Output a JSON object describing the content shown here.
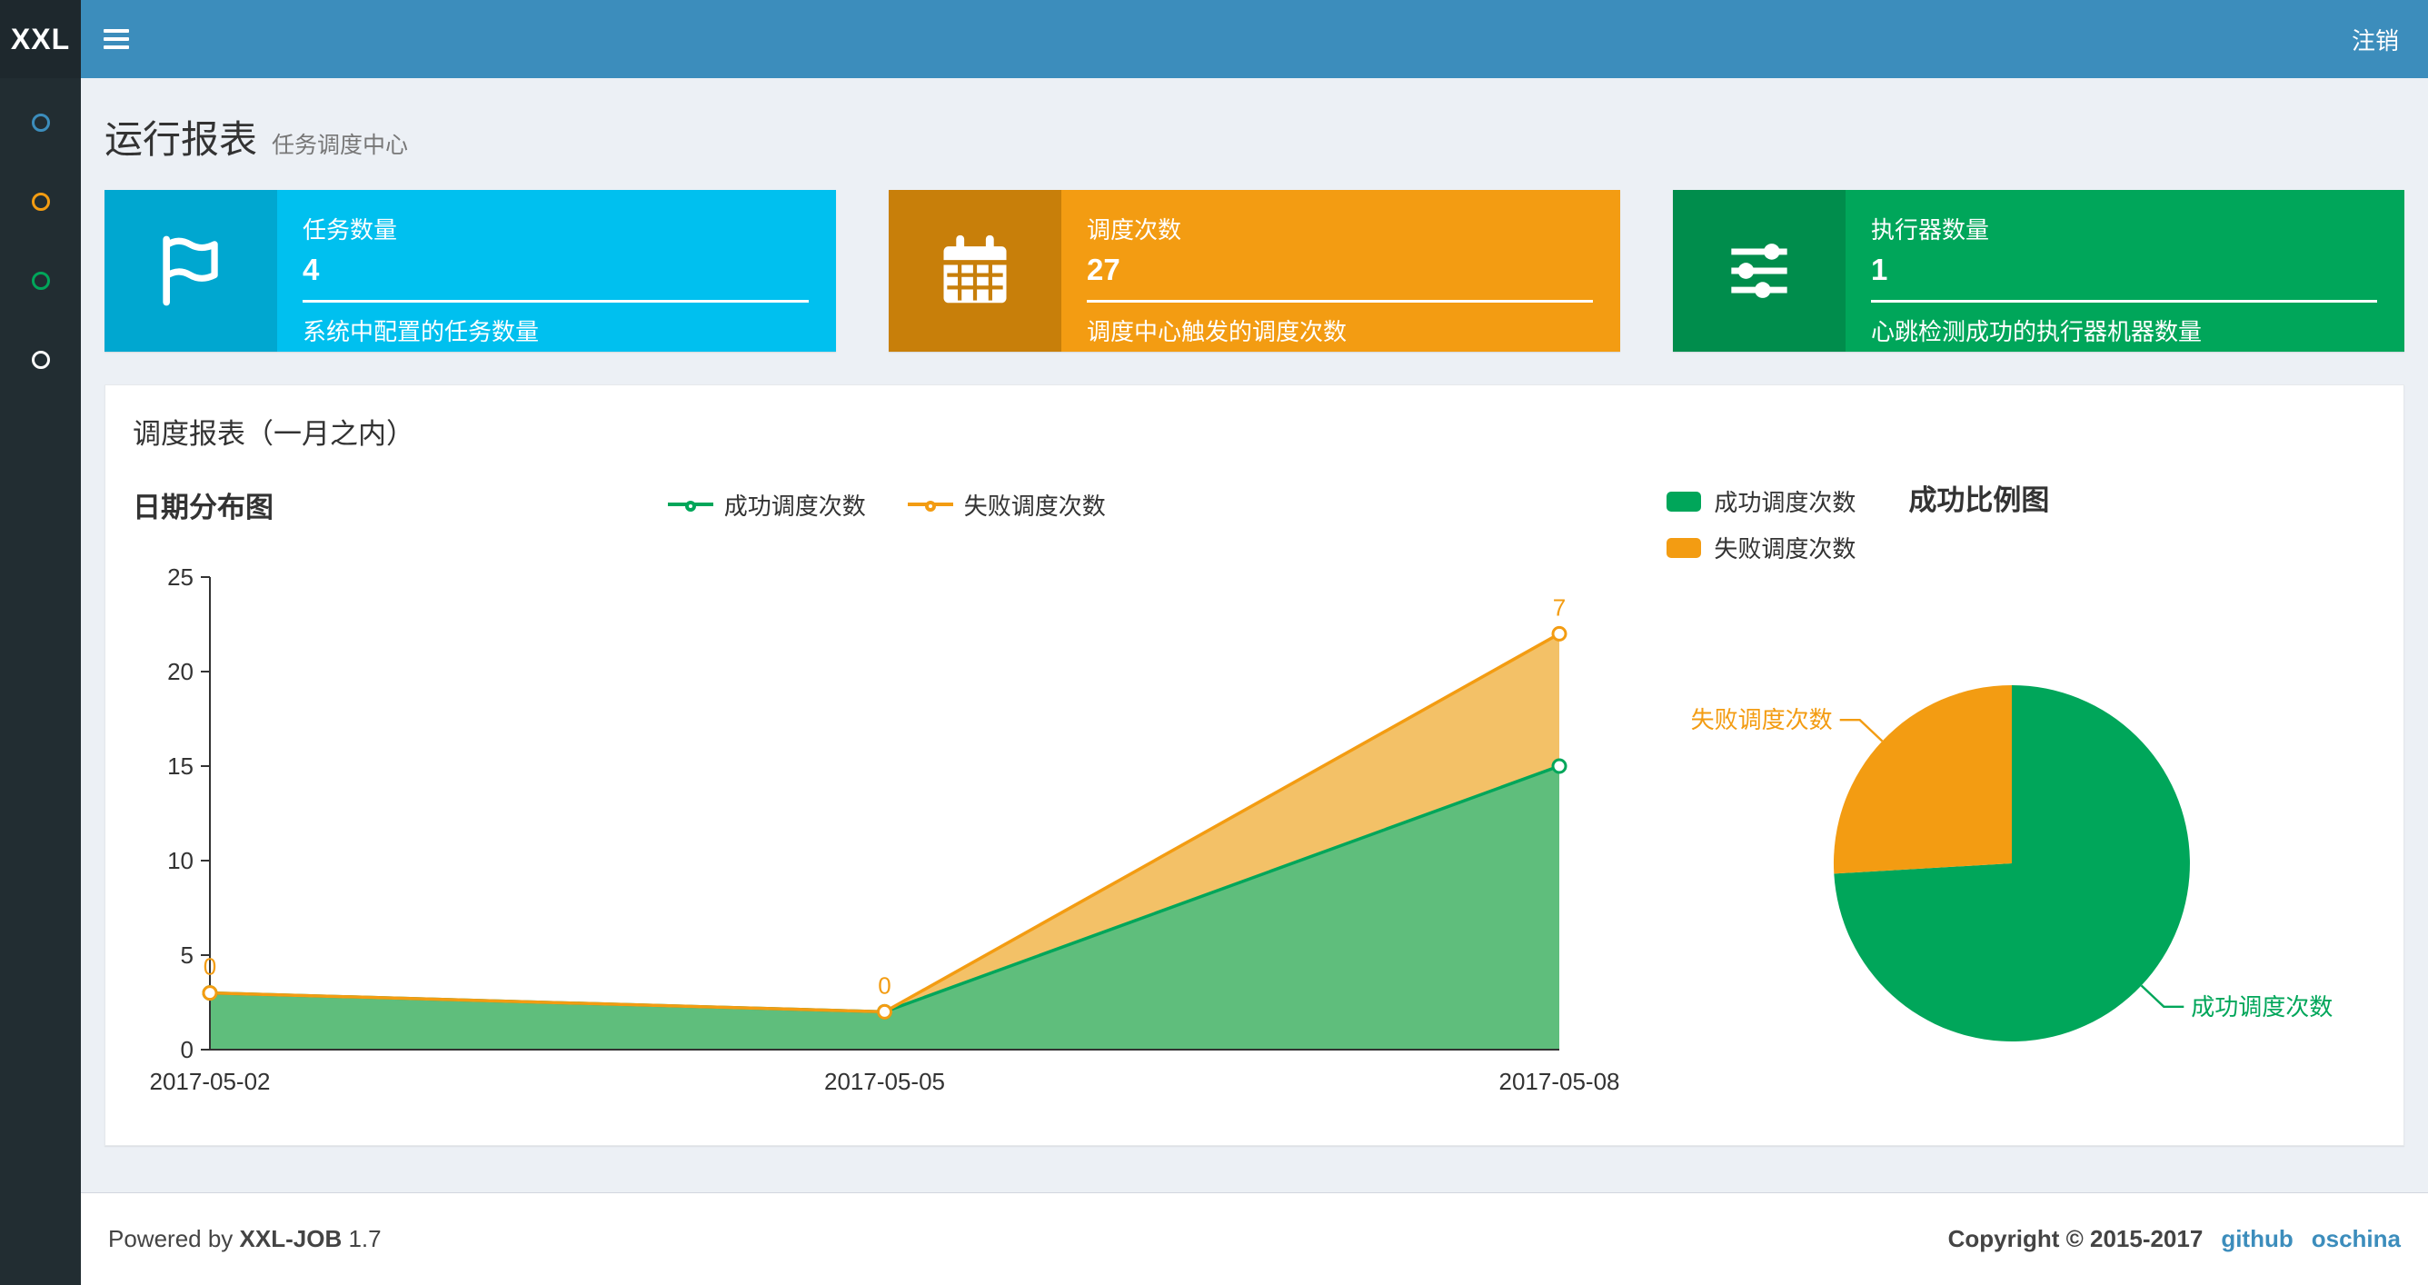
{
  "navbar": {
    "logo": "XXL",
    "menu_icon": "hamburger-menu-icon",
    "logout_label": "注销"
  },
  "sidebar": {
    "items": [
      {
        "icon": "circle-outline-icon",
        "color": "#3c8dbc"
      },
      {
        "icon": "circle-outline-icon",
        "color": "#f39c12"
      },
      {
        "icon": "circle-outline-icon",
        "color": "#00a65a"
      },
      {
        "icon": "circle-outline-icon",
        "color": "#fdfdfd"
      }
    ]
  },
  "page_header": {
    "title": "运行报表",
    "subtitle": "任务调度中心"
  },
  "info_boxes": [
    {
      "icon": "flag-icon",
      "title": "任务数量",
      "number": "4",
      "description": "系统中配置的任务数量",
      "bg_color": "#00c0ef",
      "icon_bg_color": "#00a7d0"
    },
    {
      "icon": "calendar-icon",
      "title": "调度次数",
      "number": "27",
      "description": "调度中心触发的调度次数",
      "bg_color": "#f39c12",
      "icon_bg_color": "#c87f0a"
    },
    {
      "icon": "sliders-icon",
      "title": "执行器数量",
      "number": "1",
      "description": "心跳检测成功的执行器机器数量",
      "bg_color": "#00a65a",
      "icon_bg_color": "#008d4c"
    }
  ],
  "report_panel": {
    "title": "调度报表（一月之内）"
  },
  "chart_data": [
    {
      "type": "area",
      "title": "日期分布图",
      "stacked": true,
      "categories": [
        "2017-05-02",
        "2017-05-05",
        "2017-05-08"
      ],
      "series": [
        {
          "name": "成功调度次数",
          "values": [
            3,
            2,
            15
          ],
          "color": "#00a65a",
          "area_color": "#5fbe7c"
        },
        {
          "name": "失败调度次数",
          "values": [
            0,
            0,
            7
          ],
          "color": "#f39c12",
          "area_color": "#f3c167"
        }
      ],
      "point_labels_series": "失败调度次数",
      "point_labels": [
        0,
        0,
        7
      ],
      "xlabel": "",
      "ylabel": "",
      "ylim": [
        0,
        25
      ],
      "yticks": [
        0,
        5,
        10,
        15,
        20,
        25
      ],
      "grid": false,
      "legend_position": "top-center"
    },
    {
      "type": "pie",
      "title": "成功比例图",
      "slices": [
        {
          "name": "成功调度次数",
          "value": 20,
          "color": "#00a65a"
        },
        {
          "name": "失败调度次数",
          "value": 7,
          "color": "#f39c12"
        }
      ],
      "legend_position": "top-left"
    }
  ],
  "footer": {
    "powered_by_prefix": "Powered by",
    "product": "XXL-JOB",
    "version": "1.7",
    "copyright": "Copyright © 2015-2017",
    "links": [
      {
        "label": "github"
      },
      {
        "label": "oschina"
      }
    ]
  }
}
